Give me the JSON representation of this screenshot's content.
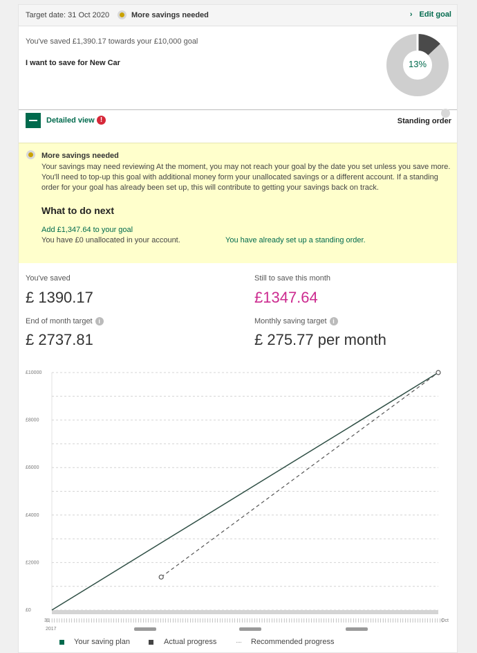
{
  "header": {
    "target_date": "Target date: 31 Oct 2020",
    "status": "More savings needed",
    "status_color": "#c9a200",
    "edit_link": "Edit goal"
  },
  "goal": {
    "saved_line": "You've saved £1,390.17 towards your £10,000 goal",
    "name": "I want to save for New Car",
    "progress_label": "13%",
    "progress_fraction": 0.13
  },
  "detail": {
    "toggle_label": "Detailed view",
    "alert_icon": "!",
    "standing_order_label": "Standing order"
  },
  "notice": {
    "title": "More savings needed",
    "body": "Your savings may need reviewing At the moment, you may not reach your goal by the date you set unless you save more. You'll need to top-up this goal with additional money form your unallocated savings or a different account. If a standing order for your goal has already been set up, this will contribute to getting your savings back on track.",
    "next_heading": "What to do next",
    "add_link": "Add £1,347.64 to your goal",
    "unallocated": "You have £0 unallocated in your account.",
    "standing_set": "You have already set up a standing order."
  },
  "stats": {
    "saved_label": "You've saved",
    "saved_value": "£ 1390.17",
    "still_label": "Still to save this month",
    "still_value": "£1347.64",
    "eom_label": "End of month target",
    "eom_value": "£ 2737.81",
    "monthly_label": "Monthly saving target",
    "monthly_value": "£ 275.77 per month",
    "info_icon": "i"
  },
  "chart_data": {
    "type": "line",
    "y_ticks": [
      "£0",
      "£2000",
      "£4000",
      "£6000",
      "£8000",
      "£10000"
    ],
    "ylim": [
      0,
      10000
    ],
    "x_start_label": "31",
    "x_start_year": "2017",
    "x_end_label": "Oct",
    "grid": true,
    "series": [
      {
        "name": "Your saving plan",
        "color": "#2f4f45",
        "style": "solid",
        "points": [
          [
            0,
            0
          ],
          [
            1,
            10000
          ]
        ]
      },
      {
        "name": "Recommended progress",
        "color": "#555555",
        "style": "dashed",
        "points": [
          [
            0.283,
            1390.17
          ],
          [
            1,
            10000
          ]
        ]
      }
    ],
    "legend": [
      {
        "name": "Your saving plan",
        "color": "#006a4d"
      },
      {
        "name": "Actual progress",
        "color": "#444444"
      },
      {
        "name": "Recommended progress",
        "color": "#999999"
      }
    ],
    "legend_position": "bottom"
  }
}
